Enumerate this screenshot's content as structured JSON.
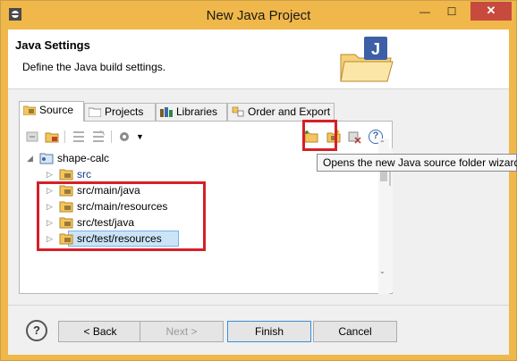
{
  "window": {
    "title": "New Java Project",
    "minimize": "—",
    "maximize": "☐",
    "close": "✕"
  },
  "header": {
    "title": "Java Settings",
    "description": "Define the Java build settings."
  },
  "tabs": [
    {
      "label": "Source",
      "active": true
    },
    {
      "label": "Projects",
      "active": false
    },
    {
      "label": "Libraries",
      "active": false
    },
    {
      "label": "Order and Export",
      "active": false
    }
  ],
  "toolbar": {
    "help": "?",
    "dropdown": "▼"
  },
  "tree": {
    "project": "shape-calc",
    "items": [
      {
        "label": "src"
      },
      {
        "label": "src/main/java"
      },
      {
        "label": "src/main/resources"
      },
      {
        "label": "src/test/java"
      },
      {
        "label": "src/test/resources",
        "selected": true
      }
    ]
  },
  "tooltip": "Opens the new Java source folder wizard",
  "buttons": {
    "help": "?",
    "back": "< Back",
    "next": "Next >",
    "finish": "Finish",
    "cancel": "Cancel"
  },
  "colors": {
    "titlebar": "#f0b74a",
    "highlight": "#d52028",
    "selection": "#cce4f7"
  }
}
